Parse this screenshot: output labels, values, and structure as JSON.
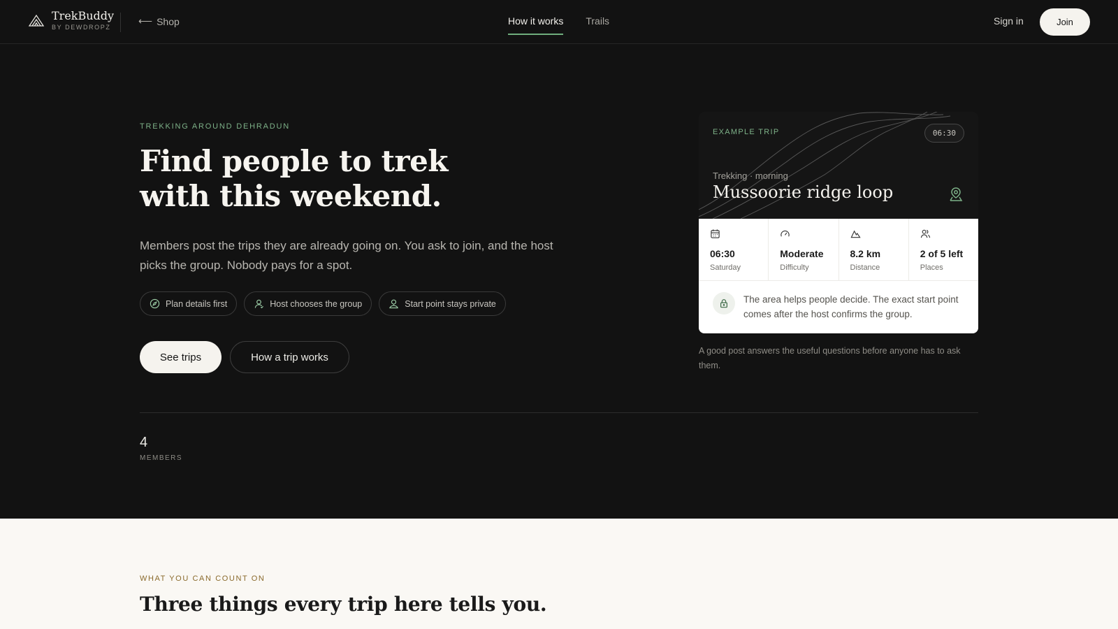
{
  "nav": {
    "brand_name": "TrekBuddy",
    "brand_sub": "BY DEWDROPZ",
    "back_arrow": "⟵",
    "shop_label": "Shop",
    "links": [
      {
        "label": "How it works",
        "active": true
      },
      {
        "label": "Trails",
        "active": false
      }
    ],
    "signin_label": "Sign in",
    "join_label": "Join"
  },
  "hero": {
    "eyebrow": "TREKKING AROUND DEHRADUN",
    "title_line1": "Find people to trek",
    "title_line2": "with this weekend.",
    "description": "Members post the trips they are already going on. You ask to join, and the host picks the group. Nobody pays for a spot.",
    "chips": [
      {
        "label": "Plan details first",
        "icon": "compass-icon"
      },
      {
        "label": "Host chooses the group",
        "icon": "user-icon"
      },
      {
        "label": "Start point stays private",
        "icon": "user-pin-icon"
      }
    ],
    "cta_primary": "See trips",
    "cta_secondary": "How a trip works"
  },
  "stats": {
    "members_count": "4",
    "members_label": "MEMBERS"
  },
  "trip_card": {
    "eyebrow": "EXAMPLE TRIP",
    "time_pill": "06:30",
    "kicker": "Trekking · morning",
    "title": "Mussoorie ridge loop",
    "metrics": [
      {
        "value": "06:30",
        "label": "Saturday",
        "icon": "calendar-icon"
      },
      {
        "value": "Moderate",
        "label": "Difficulty",
        "icon": "gauge-icon"
      },
      {
        "value": "8.2 km",
        "label": "Distance",
        "icon": "mountain-icon"
      },
      {
        "value": "2 of 5 left",
        "label": "Places",
        "icon": "users-icon"
      }
    ],
    "note": "The area helps people decide. The exact start point comes after the host confirms the group.",
    "caption": "A good post answers the useful questions before anyone has to ask them."
  },
  "section2": {
    "eyebrow": "WHAT YOU CAN COUNT ON",
    "title": "Three things every trip here tells you."
  },
  "colors": {
    "accent_green": "#6fae7d",
    "accent_gold": "#8a6a2c",
    "dark_bg": "#121212",
    "light_bg": "#faf8f4"
  }
}
